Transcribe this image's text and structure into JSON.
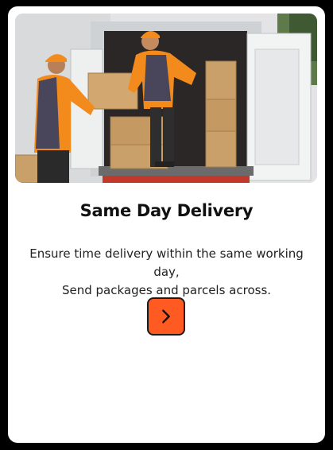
{
  "card": {
    "title": "Same Day Delivery",
    "description_lines": [
      "Ensure time delivery within the same working day,",
      "Send packages and parcels across."
    ],
    "action_icon": "chevron-right-icon",
    "accent_color": "#ff5a22"
  }
}
